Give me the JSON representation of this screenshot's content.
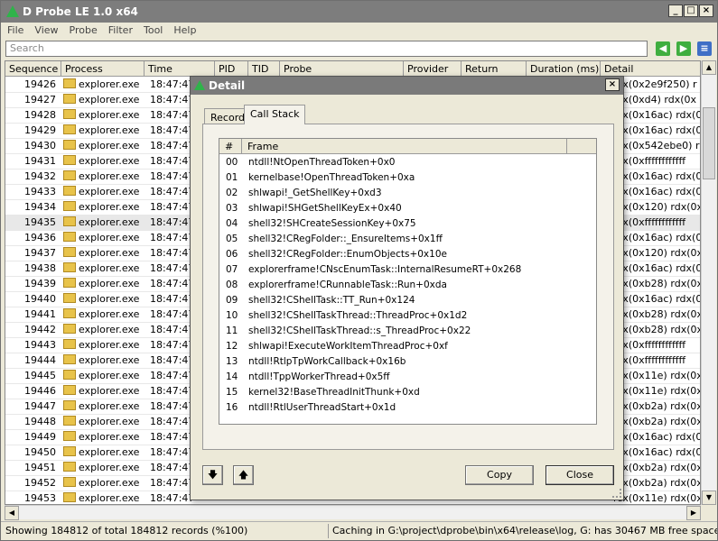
{
  "app": {
    "title": "D Probe LE 1.0 x64"
  },
  "menu": [
    "File",
    "View",
    "Probe",
    "Filter",
    "Tool",
    "Help"
  ],
  "search": {
    "placeholder": "Search"
  },
  "columns": [
    "Sequence",
    "Process",
    "Time",
    "PID",
    "TID",
    "Probe",
    "Provider",
    "Return",
    "Duration (ms)",
    "Detail"
  ],
  "rows": [
    {
      "seq": "19426",
      "proc": "explorer.exe",
      "time": "18:47:47",
      "detail": "rcx(0x2e9f250) r"
    },
    {
      "seq": "19427",
      "proc": "explorer.exe",
      "time": "18:47:47",
      "detail": "rcx(0xd4) rdx(0x"
    },
    {
      "seq": "19428",
      "proc": "explorer.exe",
      "time": "18:47:47",
      "detail": "rcx(0x16ac) rdx(0"
    },
    {
      "seq": "19429",
      "proc": "explorer.exe",
      "time": "18:47:47",
      "detail": "rcx(0x16ac) rdx(0"
    },
    {
      "seq": "19430",
      "proc": "explorer.exe",
      "time": "18:47:47",
      "detail": "rcx(0x542ebe0) r"
    },
    {
      "seq": "19431",
      "proc": "explorer.exe",
      "time": "18:47:47",
      "detail": "rcx(0xffffffffffff"
    },
    {
      "seq": "19432",
      "proc": "explorer.exe",
      "time": "18:47:47",
      "detail": "rcx(0x16ac) rdx(0"
    },
    {
      "seq": "19433",
      "proc": "explorer.exe",
      "time": "18:47:47",
      "detail": "rcx(0x16ac) rdx(0"
    },
    {
      "seq": "19434",
      "proc": "explorer.exe",
      "time": "18:47:47",
      "detail": "rcx(0x120) rdx(0x"
    },
    {
      "seq": "19435",
      "proc": "explorer.exe",
      "time": "18:47:47",
      "detail": "rcx(0xffffffffffff"
    },
    {
      "seq": "19436",
      "proc": "explorer.exe",
      "time": "18:47:47",
      "detail": "rcx(0x16ac) rdx(0"
    },
    {
      "seq": "19437",
      "proc": "explorer.exe",
      "time": "18:47:47",
      "detail": "rcx(0x120) rdx(0x"
    },
    {
      "seq": "19438",
      "proc": "explorer.exe",
      "time": "18:47:47",
      "detail": "rcx(0x16ac) rdx(0"
    },
    {
      "seq": "19439",
      "proc": "explorer.exe",
      "time": "18:47:47",
      "detail": "rcx(0xb28) rdx(0x"
    },
    {
      "seq": "19440",
      "proc": "explorer.exe",
      "time": "18:47:47",
      "detail": "rcx(0x16ac) rdx(0"
    },
    {
      "seq": "19441",
      "proc": "explorer.exe",
      "time": "18:47:47",
      "detail": "rcx(0xb28) rdx(0x"
    },
    {
      "seq": "19442",
      "proc": "explorer.exe",
      "time": "18:47:47",
      "detail": "rcx(0xb28) rdx(0x"
    },
    {
      "seq": "19443",
      "proc": "explorer.exe",
      "time": "18:47:47",
      "detail": "rcx(0xffffffffffff"
    },
    {
      "seq": "19444",
      "proc": "explorer.exe",
      "time": "18:47:47",
      "detail": "rcx(0xffffffffffff"
    },
    {
      "seq": "19445",
      "proc": "explorer.exe",
      "time": "18:47:47",
      "detail": "rcx(0x11e) rdx(0x"
    },
    {
      "seq": "19446",
      "proc": "explorer.exe",
      "time": "18:47:47",
      "detail": "rcx(0x11e) rdx(0x"
    },
    {
      "seq": "19447",
      "proc": "explorer.exe",
      "time": "18:47:47",
      "detail": "rcx(0xb2a) rdx(0x"
    },
    {
      "seq": "19448",
      "proc": "explorer.exe",
      "time": "18:47:47",
      "detail": "rcx(0xb2a) rdx(0x"
    },
    {
      "seq": "19449",
      "proc": "explorer.exe",
      "time": "18:47:47",
      "detail": "rcx(0x16ac) rdx(0"
    },
    {
      "seq": "19450",
      "proc": "explorer.exe",
      "time": "18:47:47",
      "detail": "rcx(0x16ac) rdx(0"
    },
    {
      "seq": "19451",
      "proc": "explorer.exe",
      "time": "18:47:47",
      "detail": "rcx(0xb2a) rdx(0x"
    },
    {
      "seq": "19452",
      "proc": "explorer.exe",
      "time": "18:47:47",
      "detail": "rcx(0xb2a) rdx(0x"
    },
    {
      "seq": "19453",
      "proc": "explorer.exe",
      "time": "18:47:47",
      "detail": "rcx(0x11e) rdx(0x"
    }
  ],
  "selected_row": "19435",
  "status": {
    "left": "Showing 184812 of total 184812 records (%100)",
    "right": "Caching in G:\\project\\dprobe\\bin\\x64\\release\\log, G: has 30467 MB free space"
  },
  "dialog": {
    "title": "Detail",
    "tabs": [
      "Record",
      "Call Stack"
    ],
    "active_tab": "Call Stack",
    "columns": [
      "#",
      "Frame"
    ],
    "frames": [
      {
        "n": "00",
        "frame": "ntdll!NtOpenThreadToken+0x0"
      },
      {
        "n": "01",
        "frame": "kernelbase!OpenThreadToken+0xa"
      },
      {
        "n": "02",
        "frame": "shlwapi!_GetShellKey+0xd3"
      },
      {
        "n": "03",
        "frame": "shlwapi!SHGetShellKeyEx+0x40"
      },
      {
        "n": "04",
        "frame": "shell32!SHCreateSessionKey+0x75"
      },
      {
        "n": "05",
        "frame": "shell32!CRegFolder::_EnsureItems+0x1ff"
      },
      {
        "n": "06",
        "frame": "shell32!CRegFolder::EnumObjects+0x10e"
      },
      {
        "n": "07",
        "frame": "explorerframe!CNscEnumTask::InternalResumeRT+0x268"
      },
      {
        "n": "08",
        "frame": "explorerframe!CRunnableTask::Run+0xda"
      },
      {
        "n": "09",
        "frame": "shell32!CShellTask::TT_Run+0x124"
      },
      {
        "n": "10",
        "frame": "shell32!CShellTaskThread::ThreadProc+0x1d2"
      },
      {
        "n": "11",
        "frame": "shell32!CShellTaskThread::s_ThreadProc+0x22"
      },
      {
        "n": "12",
        "frame": "shlwapi!ExecuteWorkItemThreadProc+0xf"
      },
      {
        "n": "13",
        "frame": "ntdll!RtlpTpWorkCallback+0x16b"
      },
      {
        "n": "14",
        "frame": "ntdll!TppWorkerThread+0x5ff"
      },
      {
        "n": "15",
        "frame": "kernel32!BaseThreadInitThunk+0xd"
      },
      {
        "n": "16",
        "frame": "ntdll!RtlUserThreadStart+0x1d"
      }
    ],
    "buttons": {
      "copy": "Copy",
      "close": "Close"
    }
  },
  "icons": {
    "process": "explorer-folder-icon",
    "back": "green-back-arrow-icon",
    "forward": "green-forward-arrow-icon",
    "find": "blue-find-icon"
  },
  "colors": {
    "titlebar": "#7d7d7d",
    "logo": "#2fb34a",
    "nav": "#3fae3f"
  }
}
